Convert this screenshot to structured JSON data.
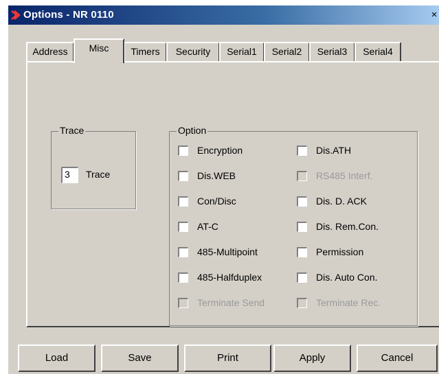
{
  "window": {
    "title": "Options - NR 0110",
    "close_glyph": "×"
  },
  "tabs": [
    {
      "label": "Address"
    },
    {
      "label": "Misc"
    },
    {
      "label": "Timers"
    },
    {
      "label": "Security"
    },
    {
      "label": "Serial1"
    },
    {
      "label": "Serial2"
    },
    {
      "label": "Serial3"
    },
    {
      "label": "Serial4"
    }
  ],
  "active_tab": "Misc",
  "trace": {
    "group_label": "Trace",
    "value": "3",
    "label": "Trace"
  },
  "option": {
    "group_label": "Option",
    "left": [
      {
        "label": "Encryption",
        "checked": false,
        "enabled": true
      },
      {
        "label": "Dis.WEB",
        "checked": false,
        "enabled": true
      },
      {
        "label": "Con/Disc",
        "checked": false,
        "enabled": true
      },
      {
        "label": "AT-C",
        "checked": false,
        "enabled": true
      },
      {
        "label": "485-Multipoint",
        "checked": false,
        "enabled": true
      },
      {
        "label": "485-Halfduplex",
        "checked": false,
        "enabled": true
      },
      {
        "label": "Terminate Send",
        "checked": false,
        "enabled": false
      }
    ],
    "right": [
      {
        "label": "Dis.ATH",
        "checked": false,
        "enabled": true
      },
      {
        "label": "RS485 Interf.",
        "checked": false,
        "enabled": false
      },
      {
        "label": "Dis. D. ACK",
        "checked": false,
        "enabled": true
      },
      {
        "label": "Dis. Rem.Con.",
        "checked": false,
        "enabled": true
      },
      {
        "label": "Permission",
        "checked": false,
        "enabled": true
      },
      {
        "label": "Dis. Auto Con.",
        "checked": false,
        "enabled": true
      },
      {
        "label": "Terminate Rec.",
        "checked": false,
        "enabled": false
      }
    ]
  },
  "buttons": {
    "load": "Load",
    "save": "Save",
    "print": "Print",
    "apply": "Apply",
    "cancel": "Cancel"
  },
  "icons": {
    "app": "options-app-icon"
  },
  "colors": {
    "titlebar_start": "#0a246a",
    "titlebar_end": "#a6caf0",
    "face": "#d4d0c8",
    "disabled_text": "#9a9a9a"
  }
}
